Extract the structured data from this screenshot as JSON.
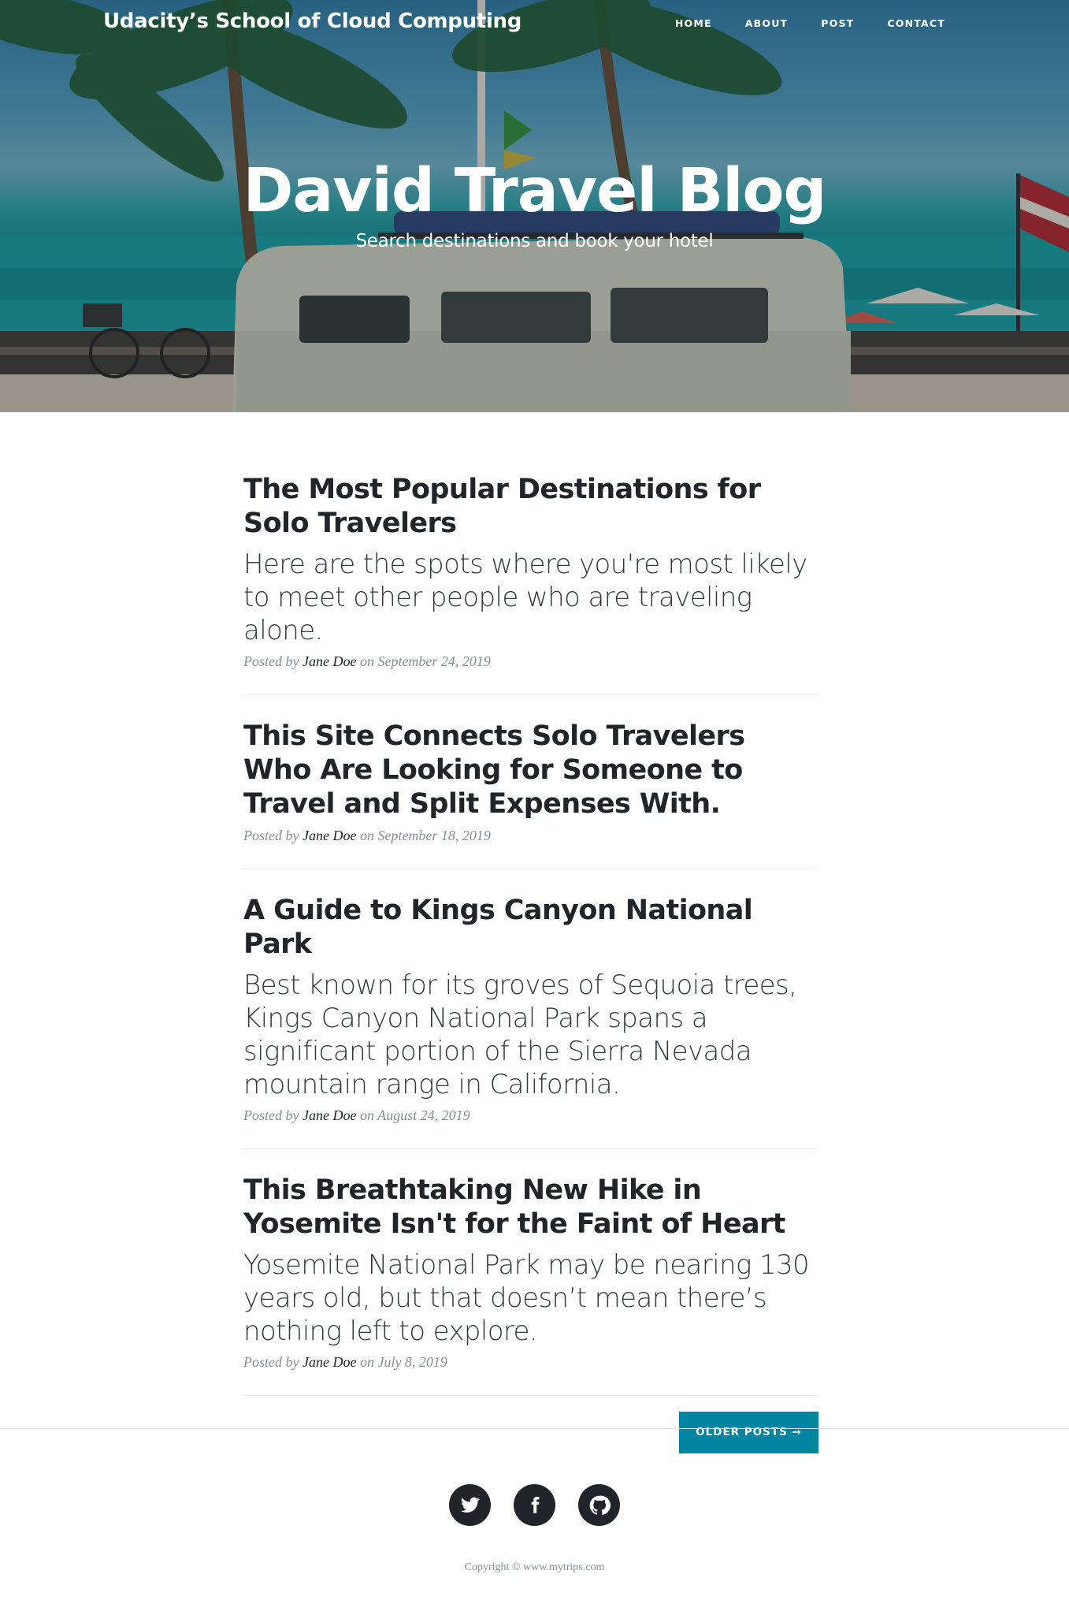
{
  "navbar": {
    "brand": "Udacity’s School of Cloud Computing",
    "links": [
      {
        "label": "HOME"
      },
      {
        "label": "ABOUT"
      },
      {
        "label": "POST"
      },
      {
        "label": "CONTACT"
      }
    ]
  },
  "header": {
    "title": "David Travel Blog",
    "subtitle": "Search destinations and book your hotel"
  },
  "posts": [
    {
      "title": "The Most Popular Destinations for Solo Travelers",
      "subtitle": "Here are the spots where you're most likely to meet other people who are traveling alone.",
      "posted_by": "Posted by",
      "author": "Jane Doe",
      "on": "on",
      "date": "September 24, 2019"
    },
    {
      "title": "This Site Connects Solo Travelers Who Are Looking for Someone to Travel and Split Expenses With.",
      "subtitle": "",
      "posted_by": "Posted by",
      "author": "Jane Doe",
      "on": "on",
      "date": "September 18, 2019"
    },
    {
      "title": "A Guide to Kings Canyon National Park",
      "subtitle": "Best known for its groves of Sequoia trees, Kings Canyon National Park spans a significant portion of the Sierra Nevada mountain range in California.",
      "posted_by": "Posted by",
      "author": "Jane Doe",
      "on": "on",
      "date": "August 24, 2019"
    },
    {
      "title": "This Breathtaking New Hike in Yosemite Isn't for the Faint of Heart",
      "subtitle": "Yosemite National Park may be nearing 130 years old, but that doesn’t mean there’s nothing left to explore.",
      "posted_by": "Posted by",
      "author": "Jane Doe",
      "on": "on",
      "date": "July 8, 2019"
    }
  ],
  "pager": {
    "older_label": "OLDER POSTS →"
  },
  "footer": {
    "social": [
      {
        "icon": "twitter-icon"
      },
      {
        "icon": "facebook-icon"
      },
      {
        "icon": "github-icon"
      }
    ],
    "copyright": "Copyright © www.mytrips.com"
  },
  "colors": {
    "accent": "#0085a1",
    "text": "#212529",
    "meta": "#868e96"
  }
}
